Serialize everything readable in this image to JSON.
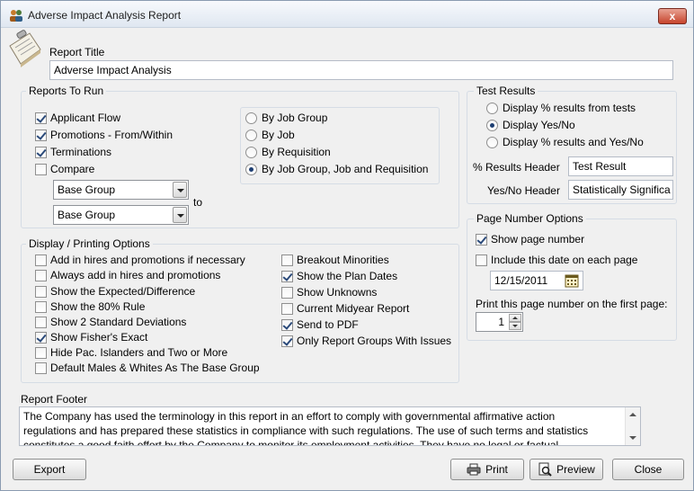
{
  "window": {
    "title": "Adverse Impact Analysis Report",
    "close_glyph": "x"
  },
  "report_title": {
    "label": "Report Title",
    "value": "Adverse Impact Analysis"
  },
  "reports_to_run": {
    "label": "Reports To Run",
    "checks": [
      {
        "label": "Applicant Flow",
        "checked": true
      },
      {
        "label": "Promotions - From/Within",
        "checked": true
      },
      {
        "label": "Terminations",
        "checked": true
      },
      {
        "label": "Compare",
        "checked": false
      }
    ],
    "combo1": "Base Group",
    "combo2": "Base Group",
    "to_label": "to",
    "grouping": [
      {
        "label": "By Job Group",
        "selected": false
      },
      {
        "label": "By Job",
        "selected": false
      },
      {
        "label": "By Requisition",
        "selected": false
      },
      {
        "label": "By Job Group, Job and Requisition",
        "selected": true
      }
    ]
  },
  "test_results": {
    "label": "Test Results",
    "options": [
      {
        "label": "Display % results from tests",
        "selected": false
      },
      {
        "label": "Display Yes/No",
        "selected": true
      },
      {
        "label": "Display % results and Yes/No",
        "selected": false
      }
    ],
    "pct_header_label": "% Results Header",
    "pct_header_value": "Test Result",
    "yesno_header_label": "Yes/No Header",
    "yesno_header_value": "Statistically Significa"
  },
  "page_number": {
    "label": "Page Number Options",
    "show_page_number": {
      "label": "Show page number",
      "checked": true
    },
    "include_date": {
      "label": "Include this date on each page",
      "checked": false
    },
    "date_value": "12/15/2011",
    "first_page_label": "Print this page number on the first page:",
    "first_page_value": "1"
  },
  "display_options": {
    "label": "Display / Printing Options",
    "left": [
      {
        "label": "Add in hires and promotions if necessary",
        "checked": false
      },
      {
        "label": "Always add in hires and promotions",
        "checked": false
      },
      {
        "label": "Show the Expected/Difference",
        "checked": false
      },
      {
        "label": "Show the 80% Rule",
        "checked": false
      },
      {
        "label": "Show 2 Standard Deviations",
        "checked": false
      },
      {
        "label": "Show Fisher's Exact",
        "checked": true
      },
      {
        "label": "Hide Pac. Islanders and Two or More",
        "checked": false
      },
      {
        "label": "Default Males & Whites As The Base Group",
        "checked": false
      }
    ],
    "right": [
      {
        "label": "Breakout Minorities",
        "checked": false
      },
      {
        "label": "Show the Plan Dates",
        "checked": true
      },
      {
        "label": "Show Unknowns",
        "checked": false
      },
      {
        "label": "Current Midyear Report",
        "checked": false
      },
      {
        "label": "Send to PDF",
        "checked": true
      },
      {
        "label": "Only Report Groups With Issues",
        "checked": true
      }
    ]
  },
  "footer": {
    "label": "Report Footer",
    "lines": [
      "The Company has used the terminology in this report in an effort to comply with governmental affirmative action",
      "regulations and has prepared these statistics in compliance with such regulations. The use of such terms and statistics",
      "constitutes a good faith effort by the Company to monitor its employment activities. They have no legal or factual"
    ]
  },
  "buttons": {
    "export": "Export",
    "print": "Print",
    "preview": "Preview",
    "close": "Close"
  },
  "icons": [
    "app-icon",
    "clipboard-icon",
    "calendar-icon",
    "printer-icon",
    "magnifier-icon"
  ]
}
